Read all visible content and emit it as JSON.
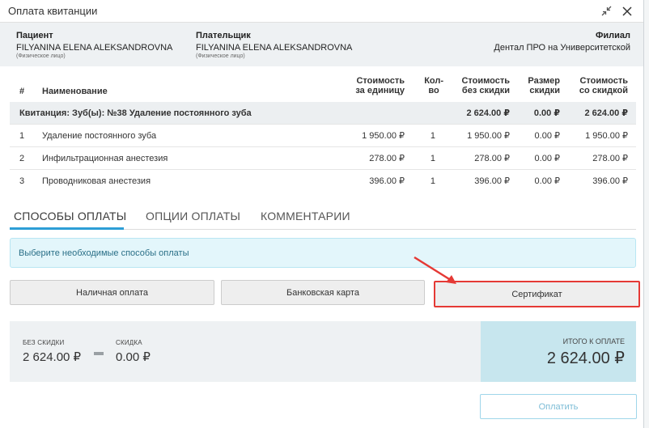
{
  "window": {
    "title": "Оплата квитанции"
  },
  "info": {
    "patient_label": "Пациент",
    "patient_name": "FILYANINA ELENA ALEKSANDROVNA",
    "patient_type": "(Физическое лицо)",
    "payer_label": "Плательщик",
    "payer_name": "FILYANINA ELENA ALEKSANDROVNA",
    "payer_type": "(Физическое лицо)",
    "branch_label": "Филиал",
    "branch_name": "Дентал ПРО на Университетской"
  },
  "table": {
    "headers": {
      "num": "#",
      "name": "Наименование",
      "unit_price_1": "Стоимость",
      "unit_price_2": "за единицу",
      "qty_1": "Кол-",
      "qty_2": "во",
      "no_disc_1": "Стоимость",
      "no_disc_2": "без скидки",
      "disc_1": "Размер",
      "disc_2": "скидки",
      "with_disc_1": "Стоимость",
      "with_disc_2": "со скидкой"
    },
    "group": {
      "label": "Квитанция: Зуб(ы): №38 Удаление постоянного зуба",
      "no_disc": "2 624.00 ₽",
      "disc": "0.00 ₽",
      "with_disc": "2 624.00 ₽"
    },
    "rows": [
      {
        "num": "1",
        "name": "Удаление постоянного зуба",
        "unit_price": "1 950.00 ₽",
        "qty": "1",
        "no_disc": "1 950.00 ₽",
        "disc": "0.00 ₽",
        "with_disc": "1 950.00 ₽"
      },
      {
        "num": "2",
        "name": "Инфильтрационная анестезия",
        "unit_price": "278.00 ₽",
        "qty": "1",
        "no_disc": "278.00 ₽",
        "disc": "0.00 ₽",
        "with_disc": "278.00 ₽"
      },
      {
        "num": "3",
        "name": "Проводниковая анестезия",
        "unit_price": "396.00 ₽",
        "qty": "1",
        "no_disc": "396.00 ₽",
        "disc": "0.00 ₽",
        "with_disc": "396.00 ₽"
      }
    ]
  },
  "tabs": [
    {
      "label": "СПОСОБЫ ОПЛАТЫ",
      "active": true
    },
    {
      "label": "ОПЦИИ ОПЛАТЫ",
      "active": false
    },
    {
      "label": "КОММЕНТАРИИ",
      "active": false
    }
  ],
  "alert": {
    "text": "Выберите необходимые способы оплаты"
  },
  "payment_methods": [
    {
      "label": "Наличная оплата",
      "highlighted": false
    },
    {
      "label": "Банковская карта",
      "highlighted": false
    },
    {
      "label": "Сертификат",
      "highlighted": true
    }
  ],
  "summary": {
    "no_disc_label": "БЕЗ СКИДКИ",
    "no_disc_value": "2 624.00 ₽",
    "disc_label": "СКИДКА",
    "disc_value": "0.00 ₽",
    "total_label": "ИТОГО К ОПЛАТЕ",
    "total_value": "2 624.00 ₽"
  },
  "submit": {
    "label": "Оплатить"
  },
  "colors": {
    "accent": "#2d9ed6",
    "highlight": "#e53935",
    "total_bg": "#c7e6ee",
    "alert_bg": "#e3f6fb"
  },
  "icons": {
    "minimize": "collapse-arrows-icon",
    "close": "close-icon"
  }
}
